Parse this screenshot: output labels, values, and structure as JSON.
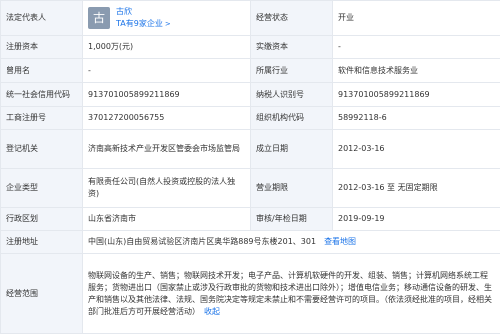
{
  "legal_rep": {
    "label": "法定代表人",
    "avatar_char": "古",
    "name": "古欣",
    "companies_link": "TA有9家企业",
    "arrow": ">"
  },
  "op_status": {
    "label": "经营状态",
    "value": "开业"
  },
  "reg_capital": {
    "label": "注册资本",
    "value": "1,000万(元)"
  },
  "paid_capital": {
    "label": "实缴资本",
    "value": "-"
  },
  "former_name": {
    "label": "曾用名",
    "value": "-"
  },
  "industry": {
    "label": "所属行业",
    "value": "软件和信息技术服务业"
  },
  "credit_code": {
    "label": "统一社会信用代码",
    "value": "913701005899211869"
  },
  "taxpayer_id": {
    "label": "纳税人识别号",
    "value": "913701005899211869"
  },
  "reg_number": {
    "label": "工商注册号",
    "value": "370127200056755"
  },
  "org_code": {
    "label": "组织机构代码",
    "value": "58992118-6"
  },
  "reg_authority": {
    "label": "登记机关",
    "value": "济南高新技术产业开发区管委会市场监管局"
  },
  "established": {
    "label": "成立日期",
    "value": "2012-03-16"
  },
  "company_type": {
    "label": "企业类型",
    "value": "有限责任公司(自然人投资或控股的法人独资)"
  },
  "business_term": {
    "label": "营业期限",
    "value": "2012-03-16 至 无固定期限"
  },
  "region": {
    "label": "行政区划",
    "value": "山东省济南市"
  },
  "approval_date": {
    "label": "审核/年检日期",
    "value": "2019-09-19"
  },
  "address": {
    "label": "注册地址",
    "value": "中国(山东)自由贸易试验区济南片区奥华路889号东楼201、301",
    "map_link": "查看地图"
  },
  "scope": {
    "label": "经营范围",
    "value": "物联网设备的生产、销售；物联网技术开发；电子产品、计算机软硬件的开发、组装、销售；计算机网络系统工程服务；货物进出口（国家禁止或涉及行政审批的货物和技术进出口除外）；增值电信业务；移动通信设备的研发、生产和销售以及其他法律、法规、国务院决定等规定未禁止和不需要经营许可的项目。（依法须经批准的项目，经相关部门批准后方可开展经营活动）",
    "collapse_link": "收起"
  }
}
